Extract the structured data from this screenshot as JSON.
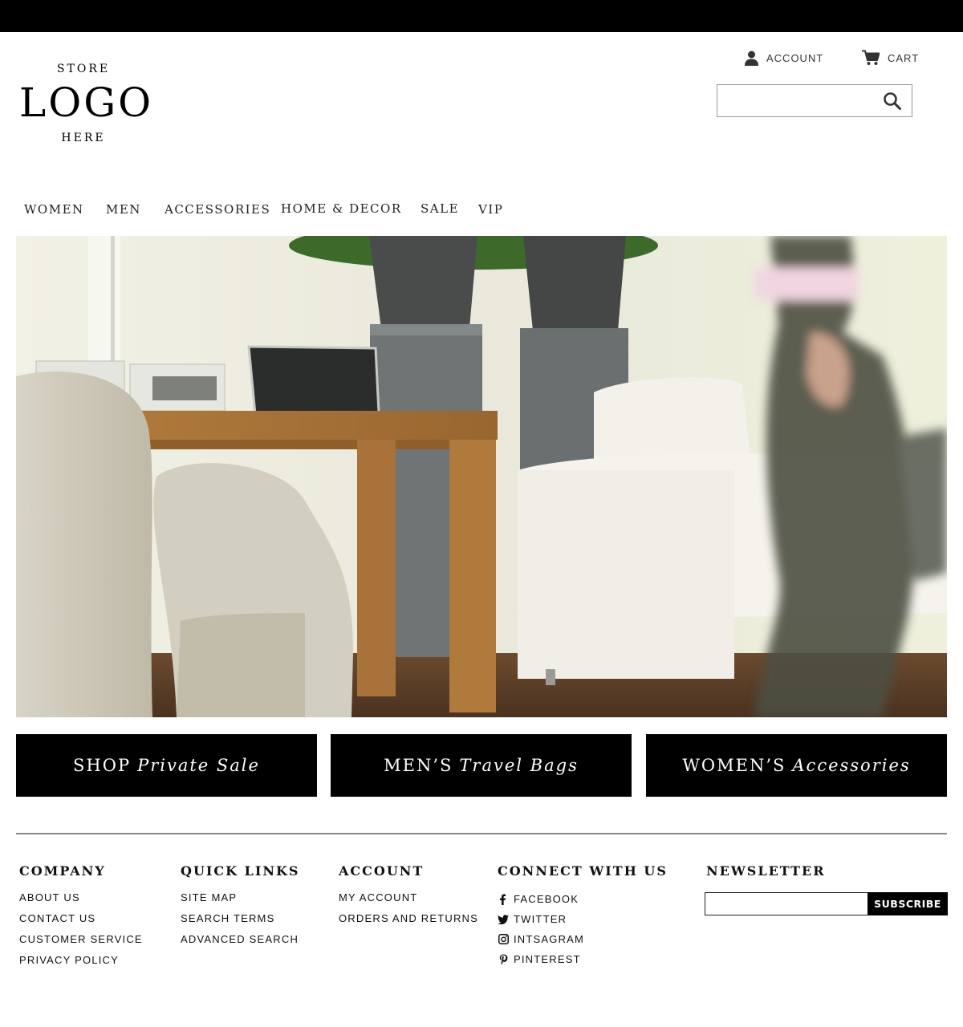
{
  "logo": {
    "top": "STORE",
    "main": "LOGO",
    "bottom": "HERE"
  },
  "header": {
    "account_label": "ACCOUNT",
    "cart_label": "CART",
    "search": {
      "value": "",
      "placeholder": ""
    }
  },
  "nav": [
    "WOMEN",
    "MEN",
    "ACCESSORIES",
    "HOME & DECOR",
    "SALE",
    "VIP"
  ],
  "promos": [
    {
      "main": "SHOP",
      "italic": "Private Sale"
    },
    {
      "main": "MEN’S",
      "italic": "Travel Bags"
    },
    {
      "main": "WOMEN’S",
      "italic": "Accessories"
    }
  ],
  "footer": {
    "company": {
      "title": "COMPANY",
      "links": [
        "ABOUT US",
        "CONTACT US",
        "CUSTOMER SERVICE",
        "PRIVACY POLICY"
      ]
    },
    "quick_links": {
      "title": "QUICK LINKS",
      "links": [
        "SITE MAP",
        "SEARCH TERMS",
        "ADVANCED SEARCH"
      ]
    },
    "account": {
      "title": "ACCOUNT",
      "links": [
        "MY ACCOUNT",
        "ORDERS AND RETURNS"
      ]
    },
    "connect": {
      "title": "CONNECT WITH US",
      "links": [
        {
          "label": "FACEBOOK",
          "icon": "facebook-icon"
        },
        {
          "label": "TWITTER",
          "icon": "twitter-icon"
        },
        {
          "label": "INTSAGRAM",
          "icon": "instagram-icon"
        },
        {
          "label": "PINTEREST",
          "icon": "pinterest-icon"
        }
      ]
    },
    "newsletter": {
      "title": "NEWSLETTER",
      "button": "SUBSCRIBE",
      "input_value": "",
      "input_placeholder": ""
    }
  },
  "colors": {
    "topbar": "#000000",
    "button_bg": "#000000",
    "button_text": "#ffffff",
    "divider": "#888888"
  }
}
